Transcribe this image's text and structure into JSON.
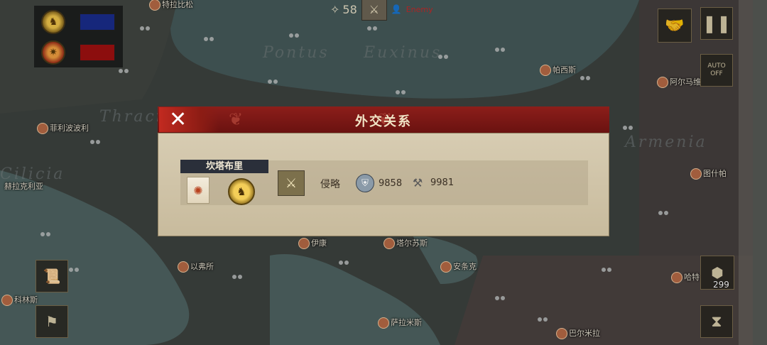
{
  "top_bar": {
    "star_icon": "star-icon",
    "turn_value": "58",
    "war_icon": "crossed-swords-icon",
    "enemy_label": "Enemy"
  },
  "faction_panel": {
    "player_color": "#1a2d8c",
    "enemy_color": "#a01010"
  },
  "map_labels": {
    "regions": [
      "Pontus",
      "Euxinus",
      "Thracia",
      "Armenia",
      "Cilicia"
    ],
    "cities": [
      "特拉比松",
      "帕西斯",
      "阿尔马维",
      "菲利波波利",
      "赫拉克利亚",
      "图什帕",
      "伊康",
      "塔尔苏斯",
      "以弗所",
      "安条克",
      "科林斯",
      "萨拉米斯",
      "巴尔米拉",
      "哈特"
    ]
  },
  "dialog": {
    "title": "外交关系",
    "close_label": "✕",
    "country_name": "坎塔布里",
    "relation": "侵略",
    "stat_shield": "9858",
    "stat_hammer": "9981"
  },
  "right_controls": {
    "auto_on": "AUTO",
    "auto_off": "OFF",
    "unit_count": "299"
  }
}
